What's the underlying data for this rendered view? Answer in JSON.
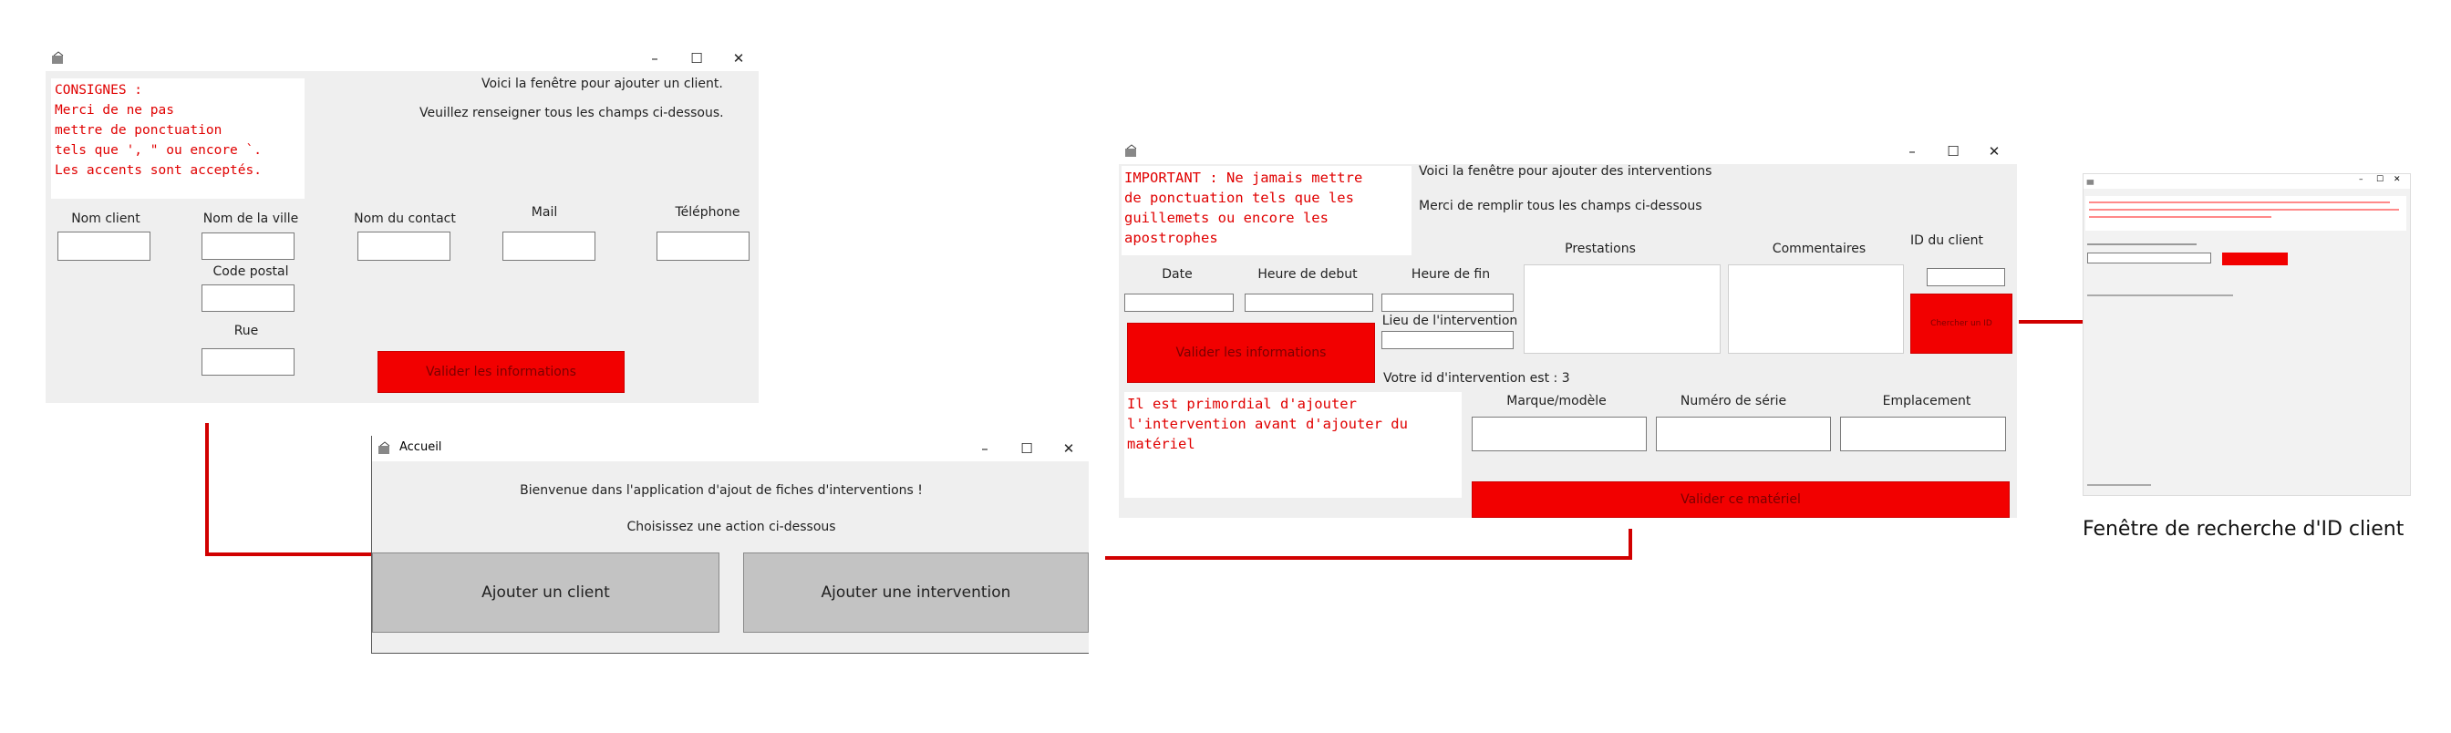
{
  "client_window": {
    "instructions": "CONSIGNES :\nMerci de ne pas\nmettre de ponctuation\ntels que ', \" ou encore `.\nLes accents sont acceptés.",
    "intro_line1": "Voici la fenêtre pour ajouter un client.",
    "intro_line2": "Veuillez renseigner tous les champs ci-dessous.",
    "labels": {
      "nom_client": "Nom client",
      "nom_ville": "Nom de la ville",
      "nom_contact": "Nom du contact",
      "mail": "Mail",
      "telephone": "Téléphone",
      "code_postal": "Code postal",
      "rue": "Rue"
    },
    "submit_label": "Valider les informations",
    "controls": {
      "minimize": "–",
      "maximize": "☐",
      "close": "✕"
    }
  },
  "home_window": {
    "title": "Accueil",
    "welcome": "Bienvenue dans l'application d'ajout de fiches d'interventions !",
    "prompt": "Choisissez une action ci-dessous",
    "add_client_label": "Ajouter un client",
    "add_intervention_label": "Ajouter une intervention",
    "controls": {
      "minimize": "–",
      "maximize": "☐",
      "close": "✕"
    }
  },
  "intervention_window": {
    "important": "IMPORTANT : Ne jamais mettre\nde ponctuation tels que les\nguillemets ou encore les\napostrophes",
    "intro_line1": "Voici la fenêtre pour ajouter des interventions",
    "intro_line2": "Merci de remplir tous les champs ci-dessous",
    "labels": {
      "date": "Date",
      "heure_debut": "Heure de debut",
      "heure_fin": "Heure de fin",
      "lieu": "Lieu de l'intervention",
      "prestations": "Prestations",
      "commentaires": "Commentaires",
      "id_client": "ID du client",
      "marque": "Marque/modèle",
      "numero_serie": "Numéro de série",
      "emplacement": "Emplacement"
    },
    "submit_info_label": "Valider les informations",
    "search_id_label": "Chercher un ID",
    "intervention_id_text": "Votre id d'intervention est : 3",
    "warning": "Il est primordial d'ajouter\nl'intervention avant d'ajouter du\nmatériel",
    "submit_material_label": "Valider ce matériel",
    "controls": {
      "minimize": "–",
      "maximize": "☐",
      "close": "✕"
    }
  },
  "search_window": {
    "caption": "Fenêtre de recherche d'ID client",
    "controls": {
      "minimize": "–",
      "maximize": "☐",
      "close": "✕"
    }
  },
  "colors": {
    "accent_red": "#f20000",
    "connector_red": "#d10000",
    "window_bg": "#efefef"
  },
  "icons": [
    "app-icon",
    "minimize-icon",
    "maximize-icon",
    "close-icon"
  ]
}
